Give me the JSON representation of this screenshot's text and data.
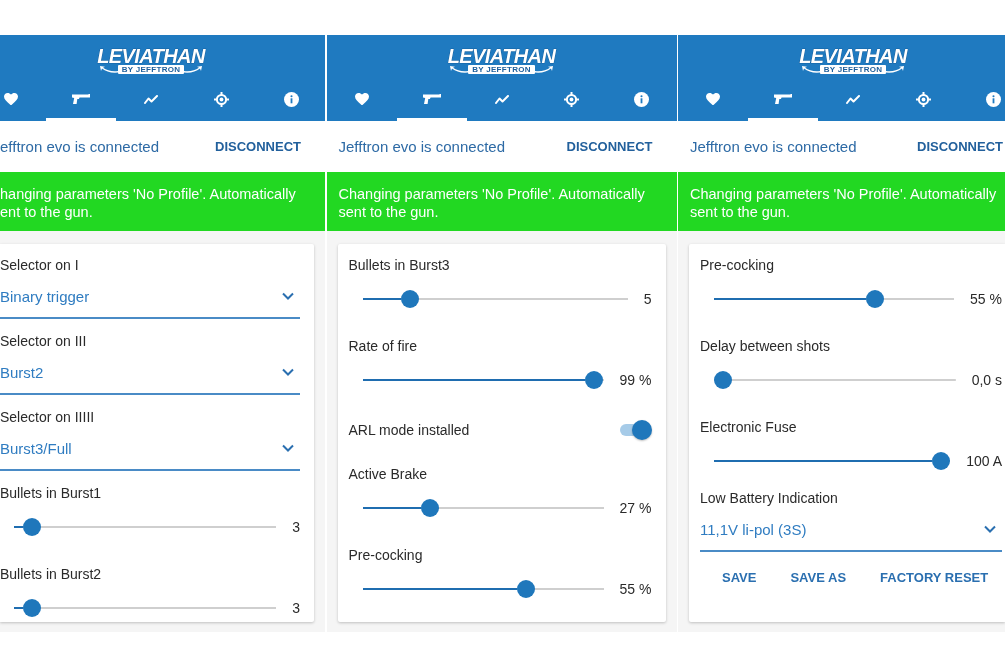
{
  "screens": [
    {
      "logo": {
        "title": "LEVIATHAN",
        "subtitle": "BY JEFFTRON"
      },
      "tabs": [
        {
          "selected": false
        },
        {
          "selected": true
        },
        {
          "selected": false
        },
        {
          "selected": false
        },
        {
          "selected": false
        }
      ],
      "connection": {
        "status": "efftron evo is connected",
        "action": "DISCONNECT"
      },
      "message": [
        "hanging parameters 'No Profile'. Automatically",
        "ent to the gun."
      ],
      "settings": [
        {
          "kind": "select",
          "label": "Selector on I",
          "value": "Binary trigger"
        },
        {
          "kind": "select",
          "label": "Selector on III",
          "value": "Burst2"
        },
        {
          "kind": "select",
          "label": "Selector on IIIII",
          "value": "Burst3/Full"
        },
        {
          "kind": "slider",
          "label": "Bullets in Burst1",
          "level": 0.07,
          "reading": "3"
        },
        {
          "kind": "slider",
          "label": "Bullets in Burst2",
          "level": 0.07,
          "reading": "3"
        }
      ]
    },
    {
      "logo": {
        "title": "LEVIATHAN",
        "subtitle": "BY JEFFTRON"
      },
      "tabs": [
        {
          "selected": false
        },
        {
          "selected": true
        },
        {
          "selected": false
        },
        {
          "selected": false
        },
        {
          "selected": false
        }
      ],
      "connection": {
        "status": "Jefftron evo is connected",
        "action": "DISCONNECT"
      },
      "message": [
        "Changing parameters 'No Profile'. Automatically",
        "sent to the gun."
      ],
      "settings": [
        {
          "kind": "slider",
          "label": "Bullets in Burst3",
          "level": 0.18,
          "reading": "5"
        },
        {
          "kind": "slider",
          "label": "Rate of fire",
          "level": 0.96,
          "reading": "99 %"
        },
        {
          "kind": "switch",
          "label": "ARL mode installed",
          "on": true
        },
        {
          "kind": "slider",
          "label": "Active Brake",
          "level": 0.28,
          "reading": "27 %"
        },
        {
          "kind": "slider",
          "label": "Pre-cocking",
          "level": 0.68,
          "reading": "55 %"
        }
      ]
    },
    {
      "logo": {
        "title": "LEVIATHAN",
        "subtitle": "BY JEFFTRON"
      },
      "tabs": [
        {
          "selected": false
        },
        {
          "selected": true
        },
        {
          "selected": false
        },
        {
          "selected": false
        },
        {
          "selected": false
        }
      ],
      "connection": {
        "status": "Jefftron evo is connected",
        "action": "DISCONNECT"
      },
      "message": [
        "Changing parameters 'No Profile'. Automatically",
        "sent to the gun."
      ],
      "settings": [
        {
          "kind": "slider",
          "label": "Pre-cocking",
          "level": 0.67,
          "reading": "55 %"
        },
        {
          "kind": "slider",
          "label": "Delay between shots",
          "level": 0.02,
          "reading": "0,0 s"
        },
        {
          "kind": "slider",
          "label": "Electronic Fuse",
          "level": 0.96,
          "reading": "100 A"
        },
        {
          "kind": "select",
          "label": "Low Battery Indication",
          "value": "11,1V li-pol (3S)"
        }
      ],
      "actions": [
        "SAVE",
        "SAVE AS",
        "FACTORY RESET"
      ]
    }
  ]
}
